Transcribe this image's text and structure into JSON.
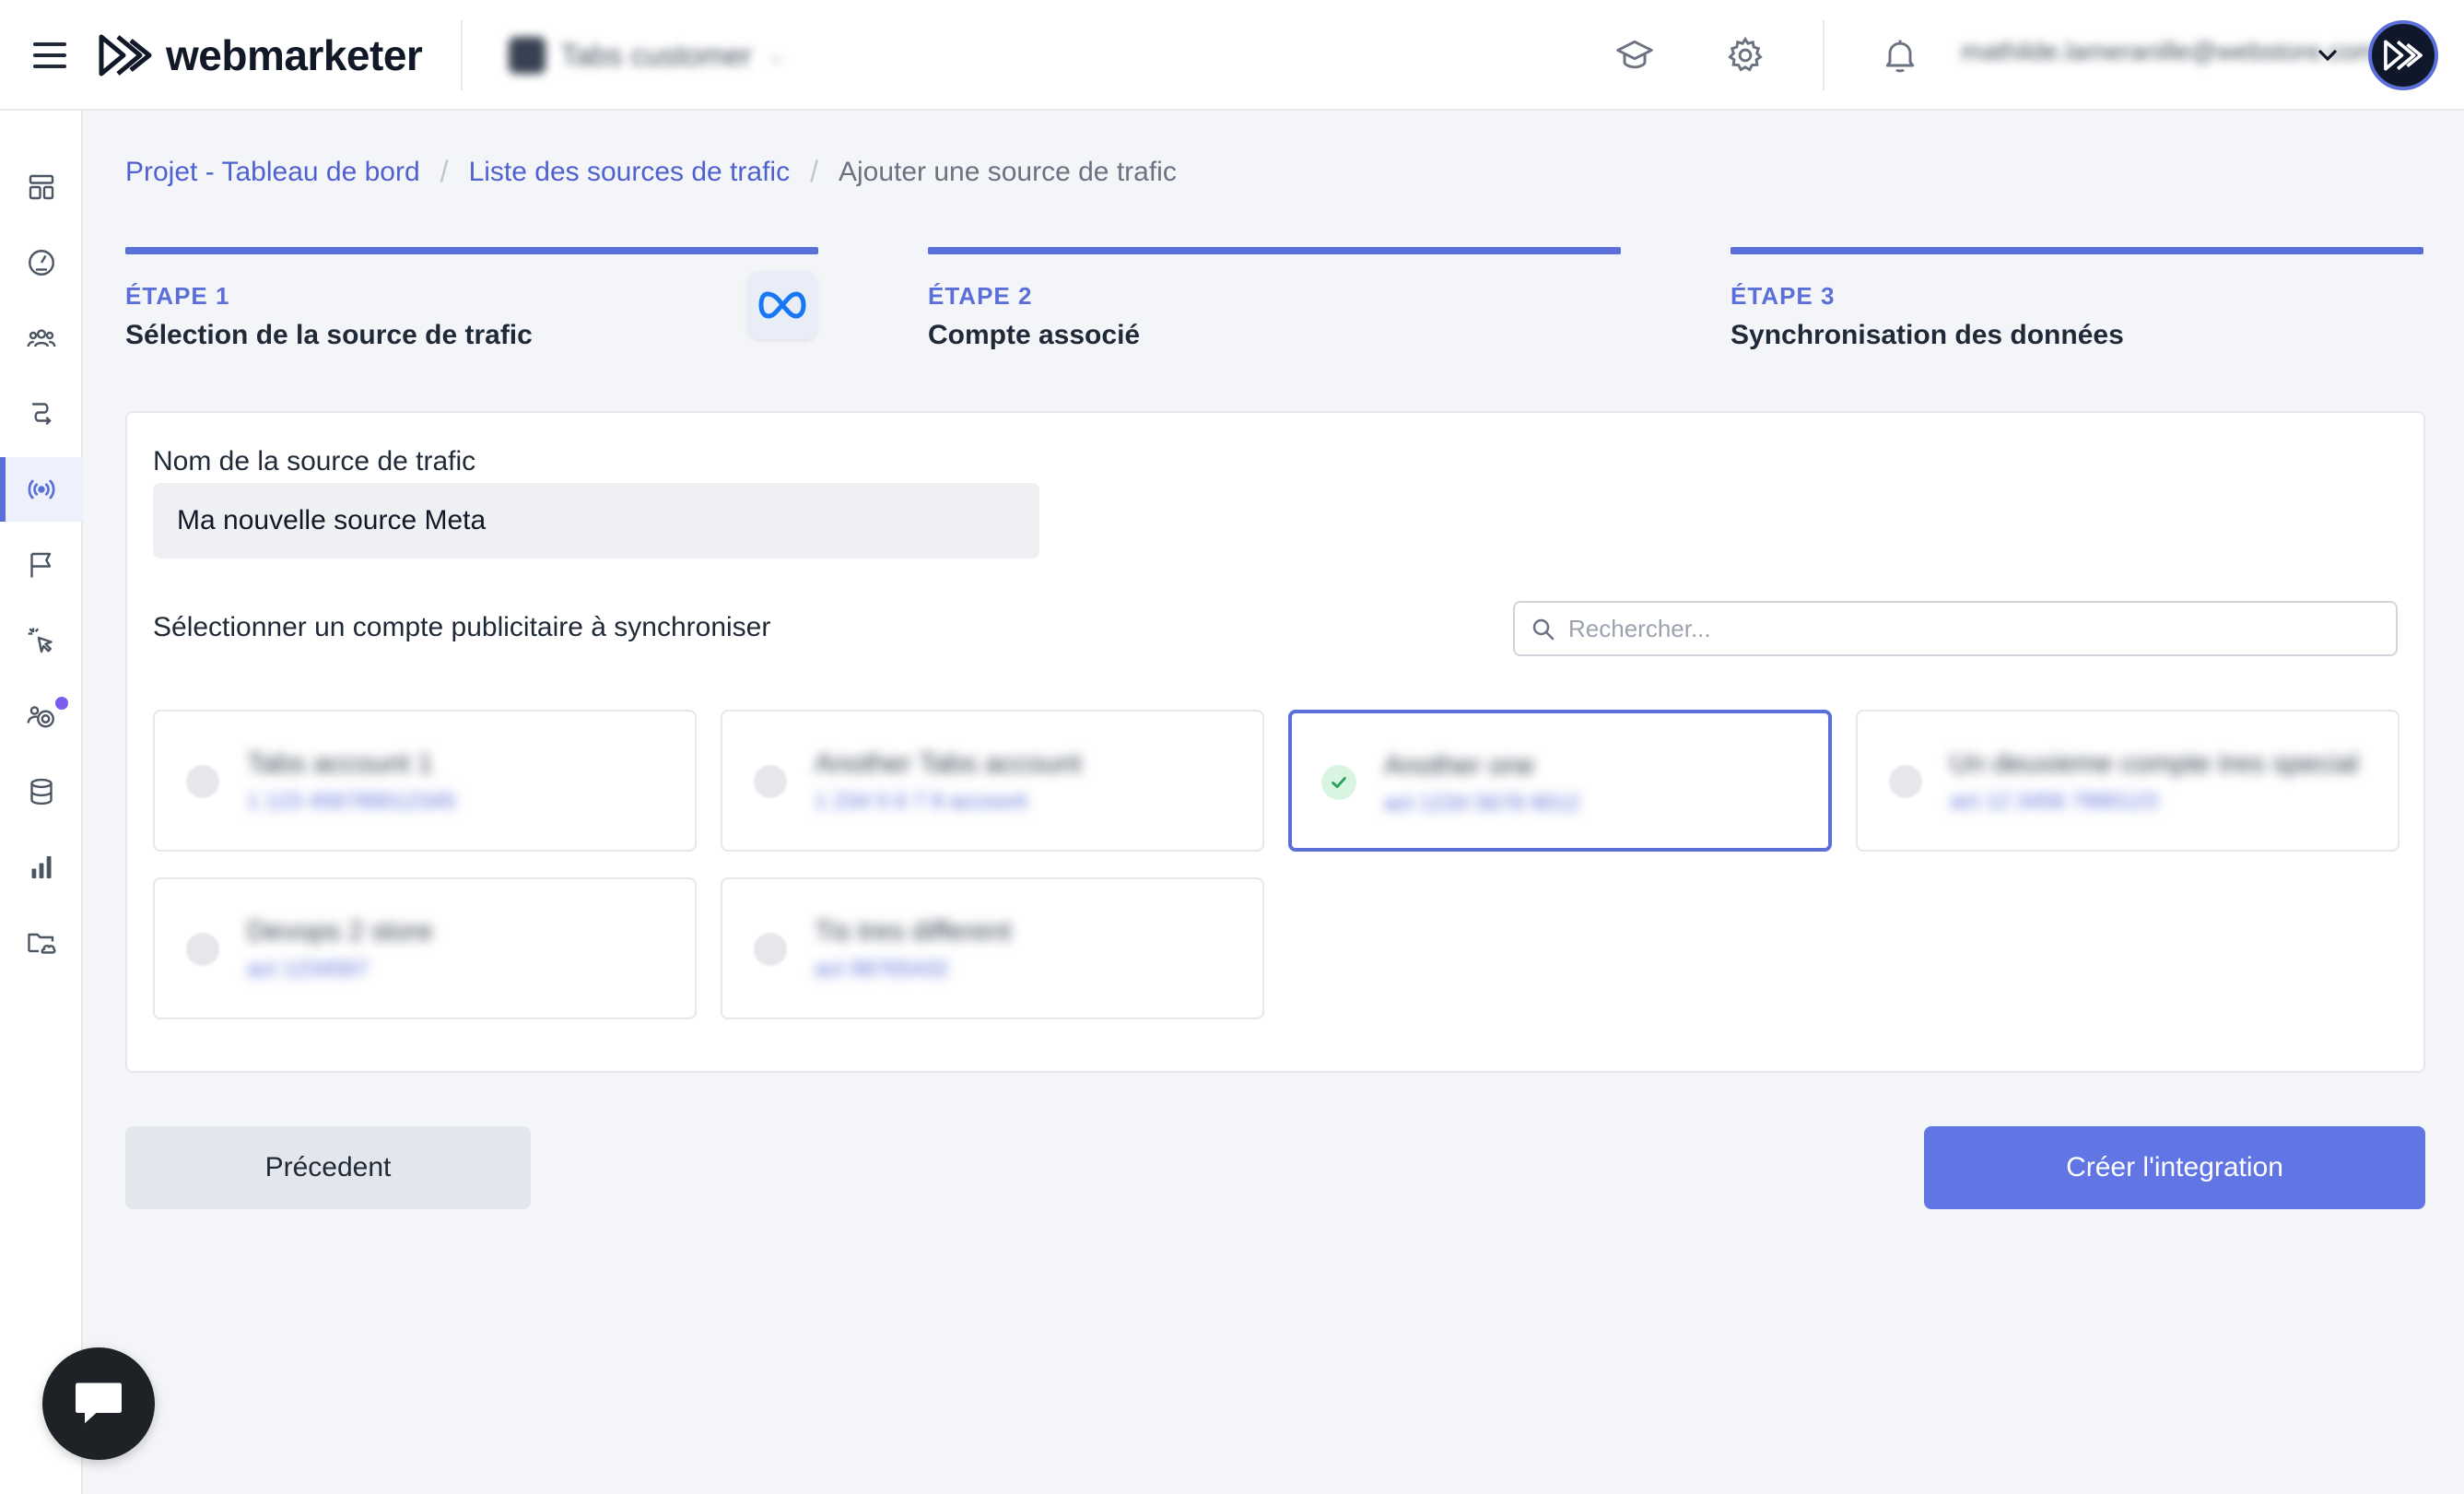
{
  "header": {
    "brand": "webmarketer",
    "project_selector": "Tabs customer",
    "user_email": "mathilde.lameranille@webstore.com"
  },
  "breadcrumb": {
    "items": [
      "Projet - Tableau de bord",
      "Liste des sources de trafic"
    ],
    "separator": "/",
    "current": "Ajouter une source de trafic"
  },
  "steps": [
    {
      "label": "ÉTAPE 1",
      "title": "Sélection de la source de trafic"
    },
    {
      "label": "ÉTAPE 2",
      "title": "Compte associé"
    },
    {
      "label": "ÉTAPE 3",
      "title": "Synchronisation des données"
    }
  ],
  "form": {
    "name_label": "Nom de la source de trafic",
    "name_value": "Ma nouvelle source Meta",
    "select_label": "Sélectionner un compte publicitaire à synchroniser",
    "search_placeholder": "Rechercher..."
  },
  "accounts": [
    {
      "name": "Tabs account 1",
      "sub": "1 123 456789012345",
      "selected": false
    },
    {
      "name": "Another Tabs account",
      "sub": "1 234 5 6 7 8 account",
      "selected": false
    },
    {
      "name": "Another one",
      "sub": "act 1234 5678 9012",
      "selected": true
    },
    {
      "name": "Un deuxieme compte tres special",
      "sub": "act 12 3456 7890123",
      "selected": false
    },
    {
      "name": "Devops 2 store",
      "sub": "act 1234567",
      "selected": false
    },
    {
      "name": "Tis tres different",
      "sub": "act 98765432",
      "selected": false
    }
  ],
  "buttons": {
    "previous": "Précedent",
    "create": "Créer l'integration"
  },
  "colors": {
    "accent": "#5b6fd8",
    "primary_button": "#6175e4"
  }
}
